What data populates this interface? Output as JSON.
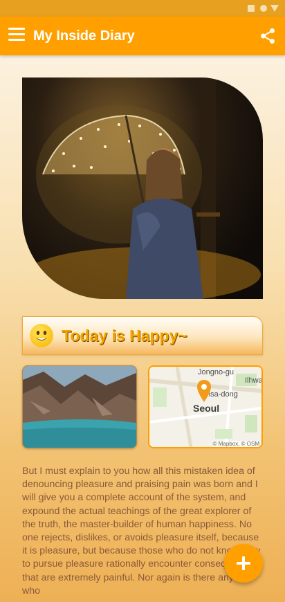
{
  "status_bar": {
    "icons": [
      "square-icon",
      "circle-icon",
      "triangle-icon"
    ]
  },
  "app_bar": {
    "title": "My Inside Diary",
    "menu_icon": "menu-icon",
    "share_icon": "share-icon",
    "color": "#ffa000"
  },
  "entry": {
    "mood": {
      "emoji_icon": "smiling-face-icon",
      "text": "Today is Happy~"
    },
    "map": {
      "labels": [
        "Jongno-gu",
        "Ilhwa",
        "nsa-dong"
      ],
      "city": "Seoul",
      "attribution": "© Mapbox, © OSM"
    },
    "body": "But I must explain to you how all this mistaken idea of denouncing pleasure and praising pain was born and I will give you a complete account of the system, and expound the actual teachings of the great explorer of the truth, the master-builder of human happiness. No one rejects, dislikes, or avoids pleasure itself, because it is pleasure, but because those who do not know how to pursue pleasure rationally encounter consequences that are extremely painful. Nor again is there anyone who"
  },
  "fab": {
    "icon": "plus-icon",
    "color": "#ffa000"
  }
}
